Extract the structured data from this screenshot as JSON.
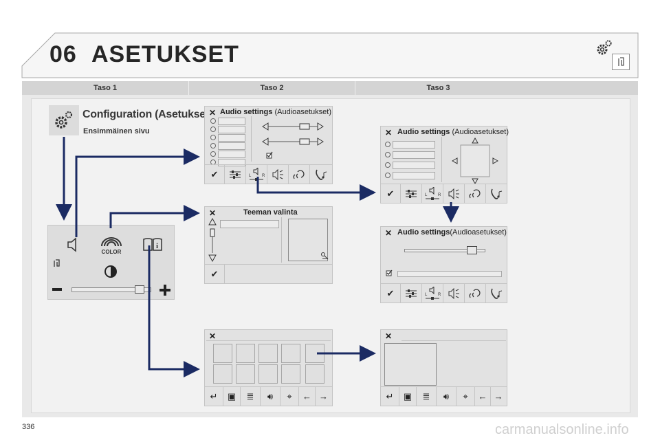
{
  "header": {
    "chapter_number": "06",
    "chapter_title": "ASETUKSET"
  },
  "levels": [
    "Taso 1",
    "Taso 2",
    "Taso 3"
  ],
  "config": {
    "title": "Configuration (Asetukset)",
    "subtitle": "Ensimmäinen sivu"
  },
  "audio_title_bold": "Audio settings",
  "audio_title_rest": " (Audioasetukset)",
  "audio_title_paren_rest": "(Audioasetukset)",
  "theme_title": "Teeman valinta",
  "main_panel": {
    "color_label": "COLOR"
  },
  "toolbar_balance": {
    "left": "L",
    "right": "R"
  },
  "page_number": "336",
  "watermark": "carmanualsonline.info",
  "colors": {
    "arrow": "#1b2b63",
    "panel_bg": "#e9e9e9",
    "screen_bg": "#e2e2e2"
  }
}
